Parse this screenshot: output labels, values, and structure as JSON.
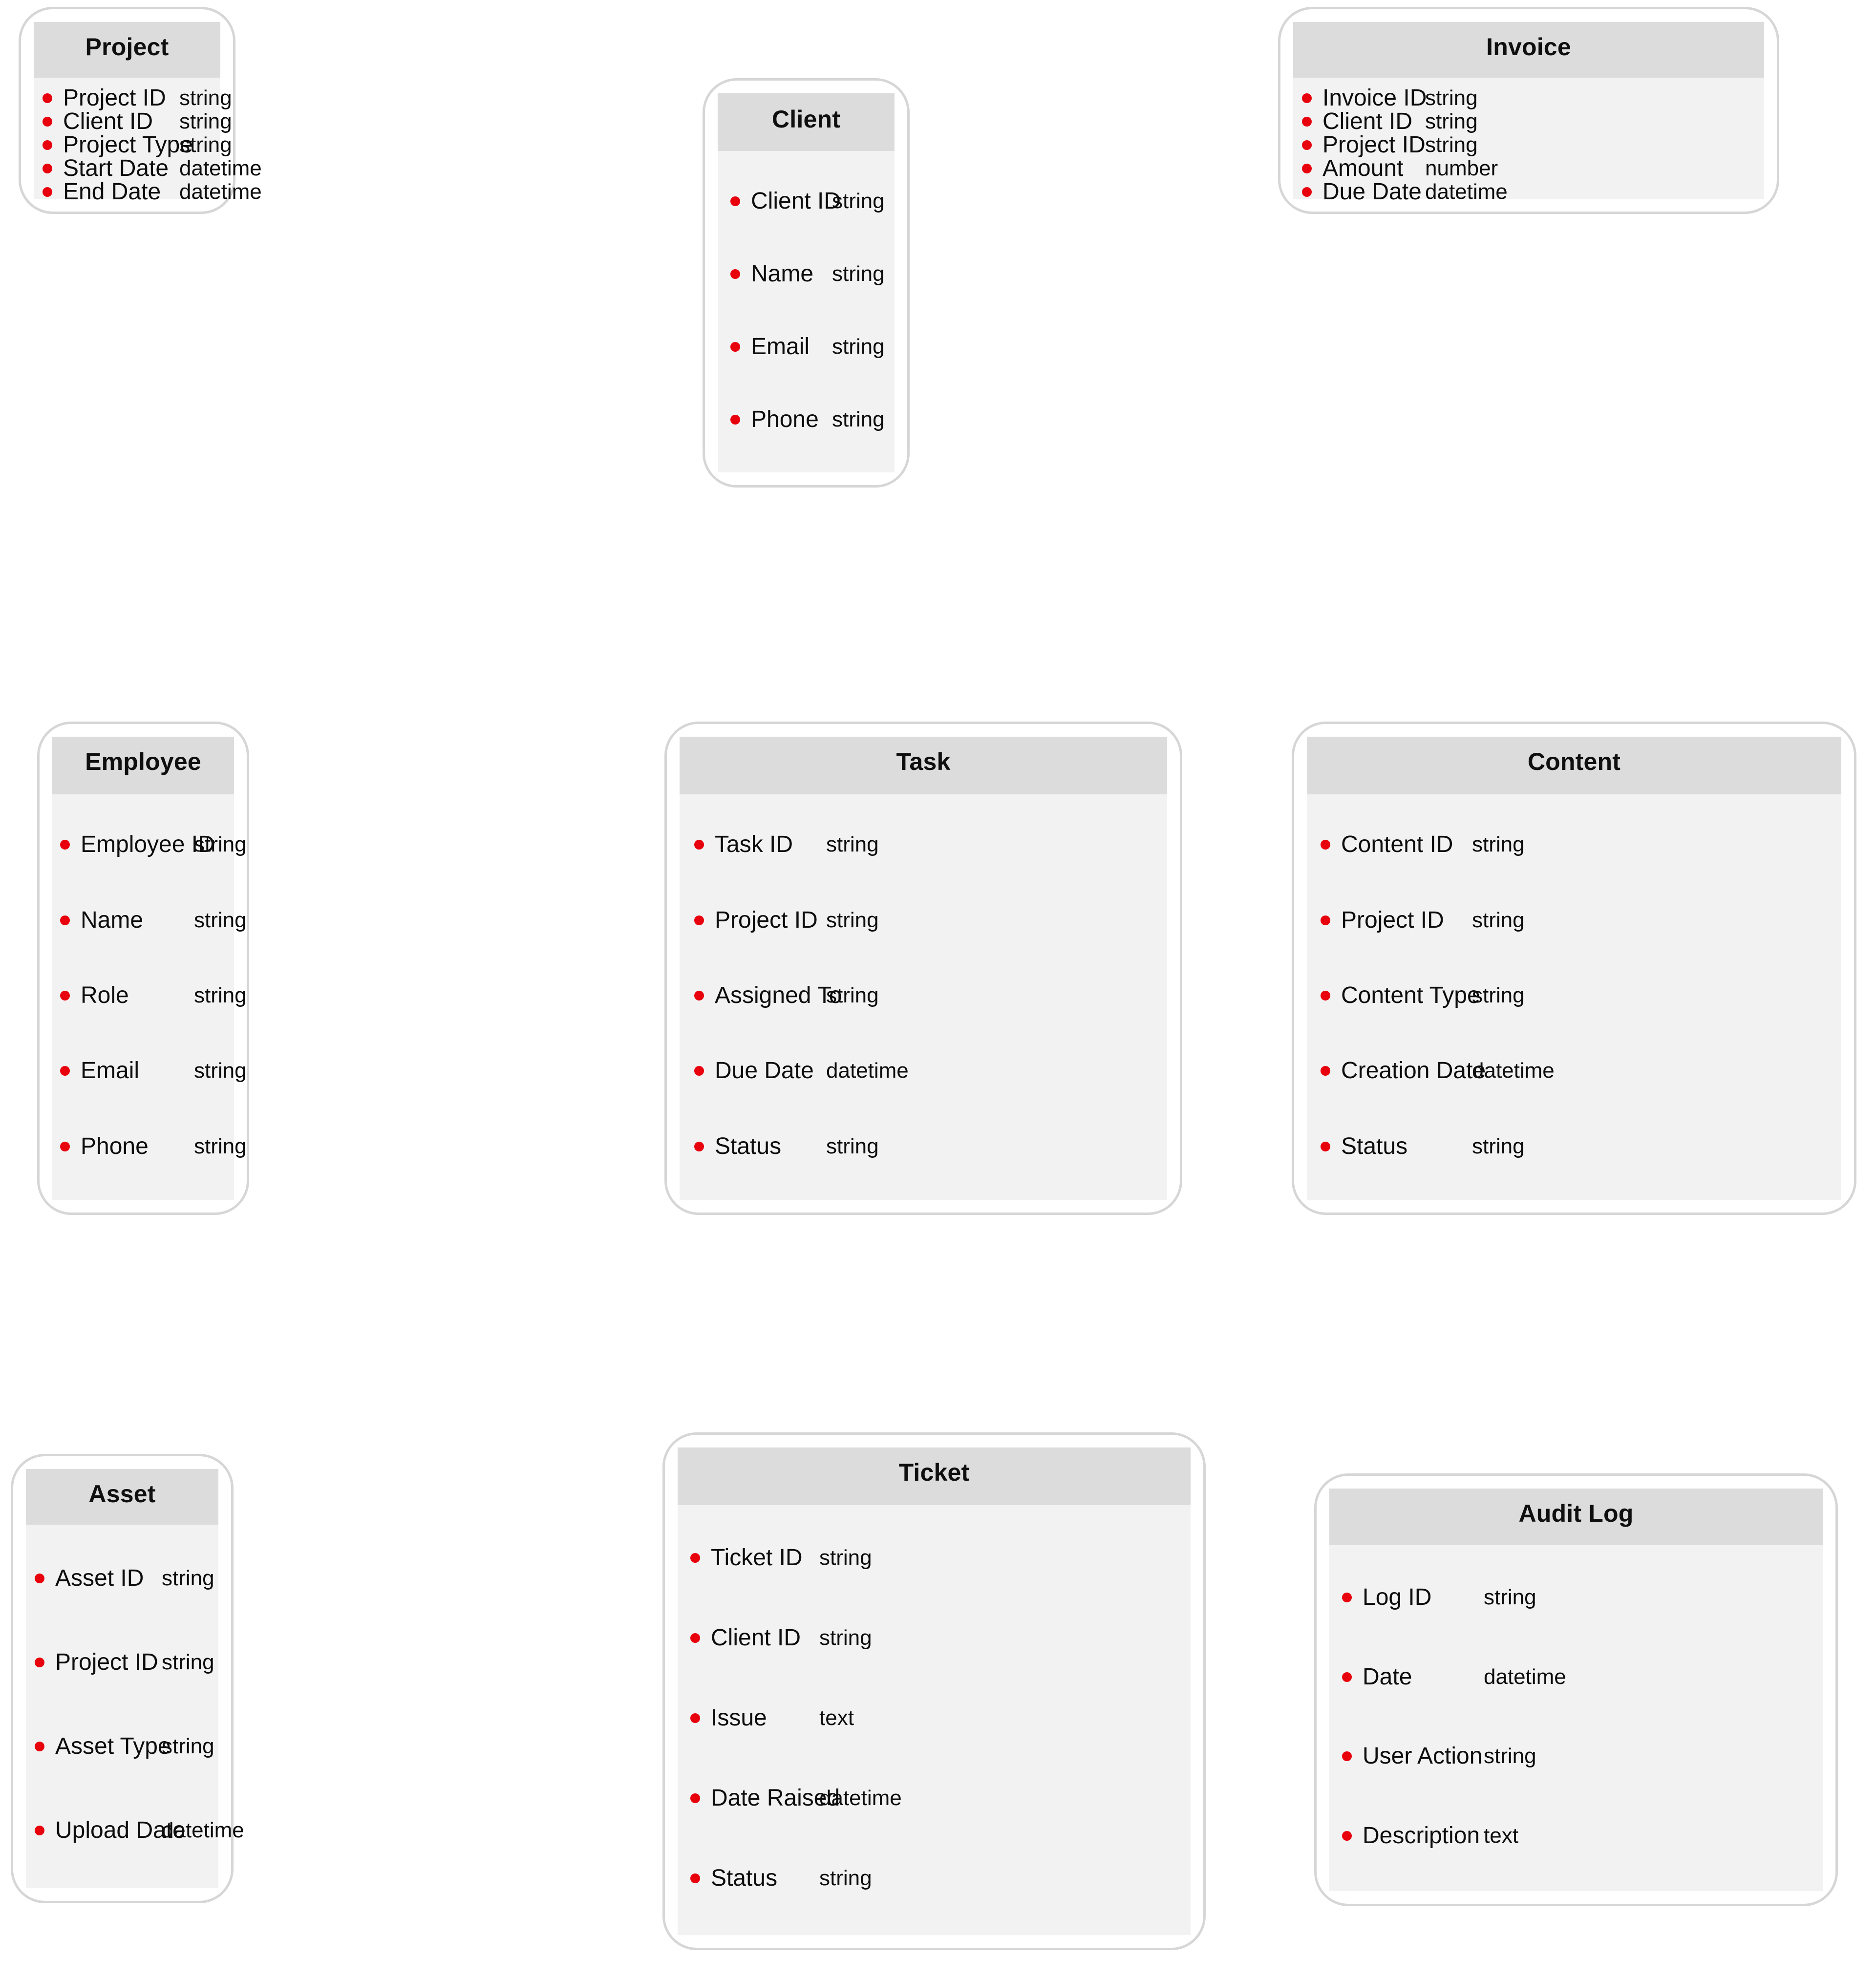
{
  "diagram": {
    "type": "entity-relationship-schema",
    "background_color": "#ffffff",
    "card_border_color": "#d6d6d6",
    "header_color": "#dcdcdc",
    "body_color": "#f2f2f2",
    "bullet_color": "#e8000d",
    "text_color": "#0d0d0d"
  },
  "entities": [
    {
      "id": "project",
      "title": "Project",
      "fields": [
        {
          "name": "Project ID",
          "type": "string"
        },
        {
          "name": "Client ID",
          "type": "string"
        },
        {
          "name": "Project Type",
          "type": "string"
        },
        {
          "name": "Start Date",
          "type": "datetime"
        },
        {
          "name": "End Date",
          "type": "datetime"
        }
      ]
    },
    {
      "id": "client",
      "title": "Client",
      "fields": [
        {
          "name": "Client ID",
          "type": "string"
        },
        {
          "name": "Name",
          "type": "string"
        },
        {
          "name": "Email",
          "type": "string"
        },
        {
          "name": "Phone",
          "type": "string"
        }
      ]
    },
    {
      "id": "invoice",
      "title": "Invoice",
      "fields": [
        {
          "name": "Invoice ID",
          "type": "string"
        },
        {
          "name": "Client ID",
          "type": "string"
        },
        {
          "name": "Project ID",
          "type": "string"
        },
        {
          "name": "Amount",
          "type": "number"
        },
        {
          "name": "Due Date",
          "type": "datetime"
        }
      ]
    },
    {
      "id": "employee",
      "title": "Employee",
      "fields": [
        {
          "name": "Employee ID",
          "type": "string"
        },
        {
          "name": "Name",
          "type": "string"
        },
        {
          "name": "Role",
          "type": "string"
        },
        {
          "name": "Email",
          "type": "string"
        },
        {
          "name": "Phone",
          "type": "string"
        }
      ]
    },
    {
      "id": "task",
      "title": "Task",
      "fields": [
        {
          "name": "Task ID",
          "type": "string"
        },
        {
          "name": "Project ID",
          "type": "string"
        },
        {
          "name": "Assigned To",
          "type": "string"
        },
        {
          "name": "Due Date",
          "type": "datetime"
        },
        {
          "name": "Status",
          "type": "string"
        }
      ]
    },
    {
      "id": "content",
      "title": "Content",
      "fields": [
        {
          "name": "Content ID",
          "type": "string"
        },
        {
          "name": "Project ID",
          "type": "string"
        },
        {
          "name": "Content Type",
          "type": "string"
        },
        {
          "name": "Creation Date",
          "type": "datetime"
        },
        {
          "name": "Status",
          "type": "string"
        }
      ]
    },
    {
      "id": "asset",
      "title": "Asset",
      "fields": [
        {
          "name": "Asset ID",
          "type": "string"
        },
        {
          "name": "Project ID",
          "type": "string"
        },
        {
          "name": "Asset Type",
          "type": "string"
        },
        {
          "name": "Upload Date",
          "type": "datetime"
        }
      ]
    },
    {
      "id": "ticket",
      "title": "Ticket",
      "fields": [
        {
          "name": "Ticket ID",
          "type": "string"
        },
        {
          "name": "Client ID",
          "type": "string"
        },
        {
          "name": "Issue",
          "type": "text"
        },
        {
          "name": "Date Raised",
          "type": "datetime"
        },
        {
          "name": "Status",
          "type": "string"
        }
      ]
    },
    {
      "id": "auditlog",
      "title": "Audit Log",
      "fields": [
        {
          "name": "Log ID",
          "type": "string"
        },
        {
          "name": "Date",
          "type": "datetime"
        },
        {
          "name": "User Action",
          "type": "string"
        },
        {
          "name": "Description",
          "type": "text"
        }
      ]
    }
  ]
}
